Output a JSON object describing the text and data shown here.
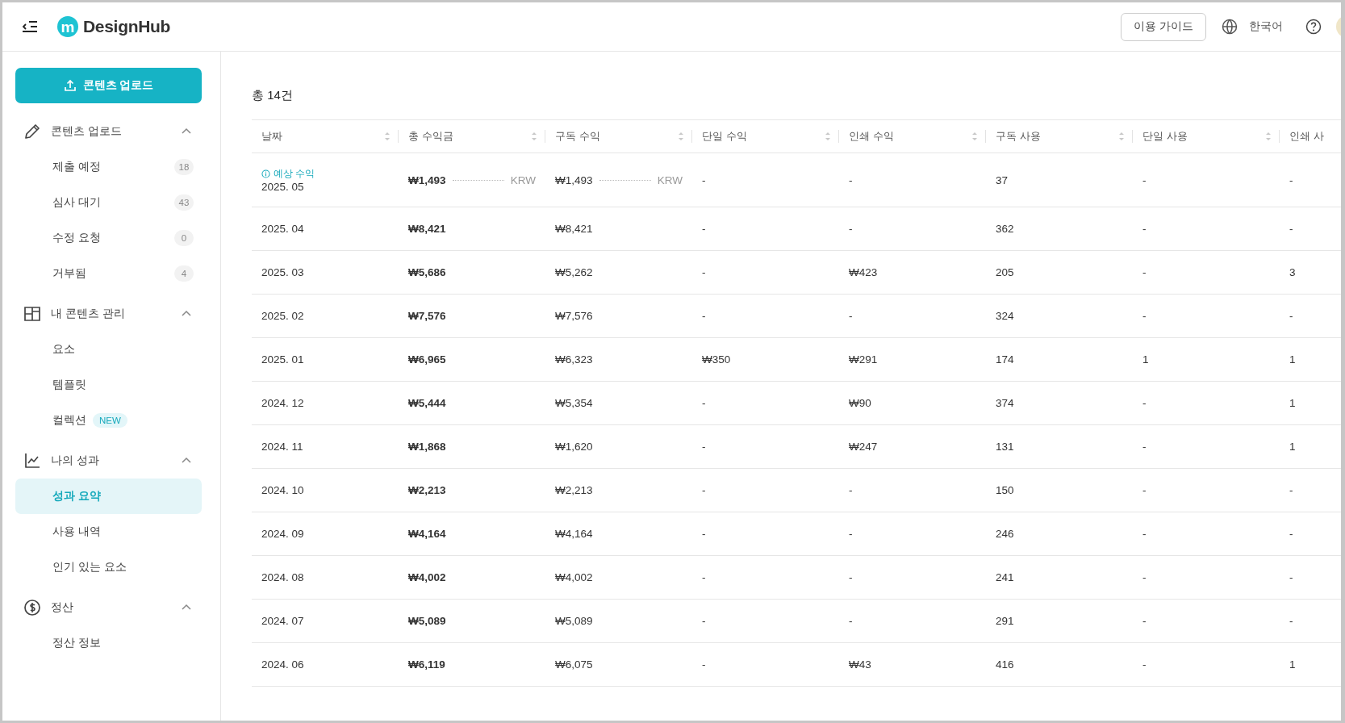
{
  "header": {
    "logo_mark": "m",
    "logo_text": "DesignHub",
    "guide_button": "이용 가이드",
    "language": "한국어"
  },
  "sidebar": {
    "upload_button": "콘텐츠 업로드",
    "sections": [
      {
        "kind": "pencil",
        "label": "콘텐츠 업로드",
        "expanded": true,
        "items": [
          {
            "label": "제출 예정",
            "count": "18",
            "selected": false
          },
          {
            "label": "심사 대기",
            "count": "43",
            "selected": false
          },
          {
            "label": "수정 요청",
            "count": "0",
            "selected": false
          },
          {
            "label": "거부됨",
            "count": "4",
            "selected": false
          }
        ]
      },
      {
        "kind": "layout",
        "label": "내 콘텐츠 관리",
        "expanded": true,
        "items": [
          {
            "label": "요소",
            "selected": false
          },
          {
            "label": "템플릿",
            "selected": false
          },
          {
            "label": "컬렉션",
            "badge": "NEW",
            "selected": false
          }
        ]
      },
      {
        "kind": "chart",
        "label": "나의 성과",
        "expanded": true,
        "items": [
          {
            "label": "성과 요약",
            "selected": true
          },
          {
            "label": "사용 내역",
            "selected": false
          },
          {
            "label": "인기 있는 요소",
            "selected": false
          }
        ]
      },
      {
        "kind": "dollar",
        "label": "정산",
        "expanded": true,
        "items": [
          {
            "label": "정산 정보",
            "selected": false
          }
        ]
      }
    ]
  },
  "content": {
    "total": "총 14건",
    "table": {
      "columns": [
        {
          "label": "날짜",
          "sortable": true
        },
        {
          "label": "총 수익금",
          "sortable": true
        },
        {
          "label": "구독 수익",
          "sortable": true
        },
        {
          "label": "단일 수익",
          "sortable": true
        },
        {
          "label": "인쇄 수익",
          "sortable": true
        },
        {
          "label": "구독 사용",
          "sortable": true
        },
        {
          "label": "단일 사용",
          "sortable": true
        },
        {
          "label": "인쇄 사",
          "sortable": false
        }
      ],
      "rows": [
        {
          "note": "예상 수익",
          "cells": [
            {
              "text": "2025. 05"
            },
            {
              "text": "₩1,493",
              "unit": "KRW"
            },
            {
              "text": "₩1,493",
              "unit": "KRW"
            },
            {
              "text": "-"
            },
            {
              "text": "-"
            },
            {
              "text": "37"
            },
            {
              "text": "-"
            },
            {
              "text": "-"
            }
          ]
        },
        {
          "cells": [
            {
              "text": "2025. 04"
            },
            {
              "text": "₩8,421"
            },
            {
              "text": "₩8,421"
            },
            {
              "text": "-"
            },
            {
              "text": "-"
            },
            {
              "text": "362"
            },
            {
              "text": "-"
            },
            {
              "text": "-"
            }
          ]
        },
        {
          "cells": [
            {
              "text": "2025. 03"
            },
            {
              "text": "₩5,686"
            },
            {
              "text": "₩5,262"
            },
            {
              "text": "-"
            },
            {
              "text": "₩423"
            },
            {
              "text": "205"
            },
            {
              "text": "-"
            },
            {
              "text": "3"
            }
          ]
        },
        {
          "cells": [
            {
              "text": "2025. 02"
            },
            {
              "text": "₩7,576"
            },
            {
              "text": "₩7,576"
            },
            {
              "text": "-"
            },
            {
              "text": "-"
            },
            {
              "text": "324"
            },
            {
              "text": "-"
            },
            {
              "text": "-"
            }
          ]
        },
        {
          "cells": [
            {
              "text": "2025. 01"
            },
            {
              "text": "₩6,965"
            },
            {
              "text": "₩6,323"
            },
            {
              "text": "₩350"
            },
            {
              "text": "₩291"
            },
            {
              "text": "174"
            },
            {
              "text": "1"
            },
            {
              "text": "1"
            }
          ]
        },
        {
          "cells": [
            {
              "text": "2024. 12"
            },
            {
              "text": "₩5,444"
            },
            {
              "text": "₩5,354"
            },
            {
              "text": "-"
            },
            {
              "text": "₩90"
            },
            {
              "text": "374"
            },
            {
              "text": "-"
            },
            {
              "text": "1"
            }
          ]
        },
        {
          "cells": [
            {
              "text": "2024. 11"
            },
            {
              "text": "₩1,868"
            },
            {
              "text": "₩1,620"
            },
            {
              "text": "-"
            },
            {
              "text": "₩247"
            },
            {
              "text": "131"
            },
            {
              "text": "-"
            },
            {
              "text": "1"
            }
          ]
        },
        {
          "cells": [
            {
              "text": "2024. 10"
            },
            {
              "text": "₩2,213"
            },
            {
              "text": "₩2,213"
            },
            {
              "text": "-"
            },
            {
              "text": "-"
            },
            {
              "text": "150"
            },
            {
              "text": "-"
            },
            {
              "text": "-"
            }
          ]
        },
        {
          "cells": [
            {
              "text": "2024. 09"
            },
            {
              "text": "₩4,164"
            },
            {
              "text": "₩4,164"
            },
            {
              "text": "-"
            },
            {
              "text": "-"
            },
            {
              "text": "246"
            },
            {
              "text": "-"
            },
            {
              "text": "-"
            }
          ]
        },
        {
          "cells": [
            {
              "text": "2024. 08"
            },
            {
              "text": "₩4,002"
            },
            {
              "text": "₩4,002"
            },
            {
              "text": "-"
            },
            {
              "text": "-"
            },
            {
              "text": "241"
            },
            {
              "text": "-"
            },
            {
              "text": "-"
            }
          ]
        },
        {
          "cells": [
            {
              "text": "2024. 07"
            },
            {
              "text": "₩5,089"
            },
            {
              "text": "₩5,089"
            },
            {
              "text": "-"
            },
            {
              "text": "-"
            },
            {
              "text": "291"
            },
            {
              "text": "-"
            },
            {
              "text": "-"
            }
          ]
        },
        {
          "cells": [
            {
              "text": "2024. 06"
            },
            {
              "text": "₩6,119"
            },
            {
              "text": "₩6,075"
            },
            {
              "text": "-"
            },
            {
              "text": "₩43"
            },
            {
              "text": "416"
            },
            {
              "text": "-"
            },
            {
              "text": "1"
            }
          ]
        }
      ]
    }
  }
}
